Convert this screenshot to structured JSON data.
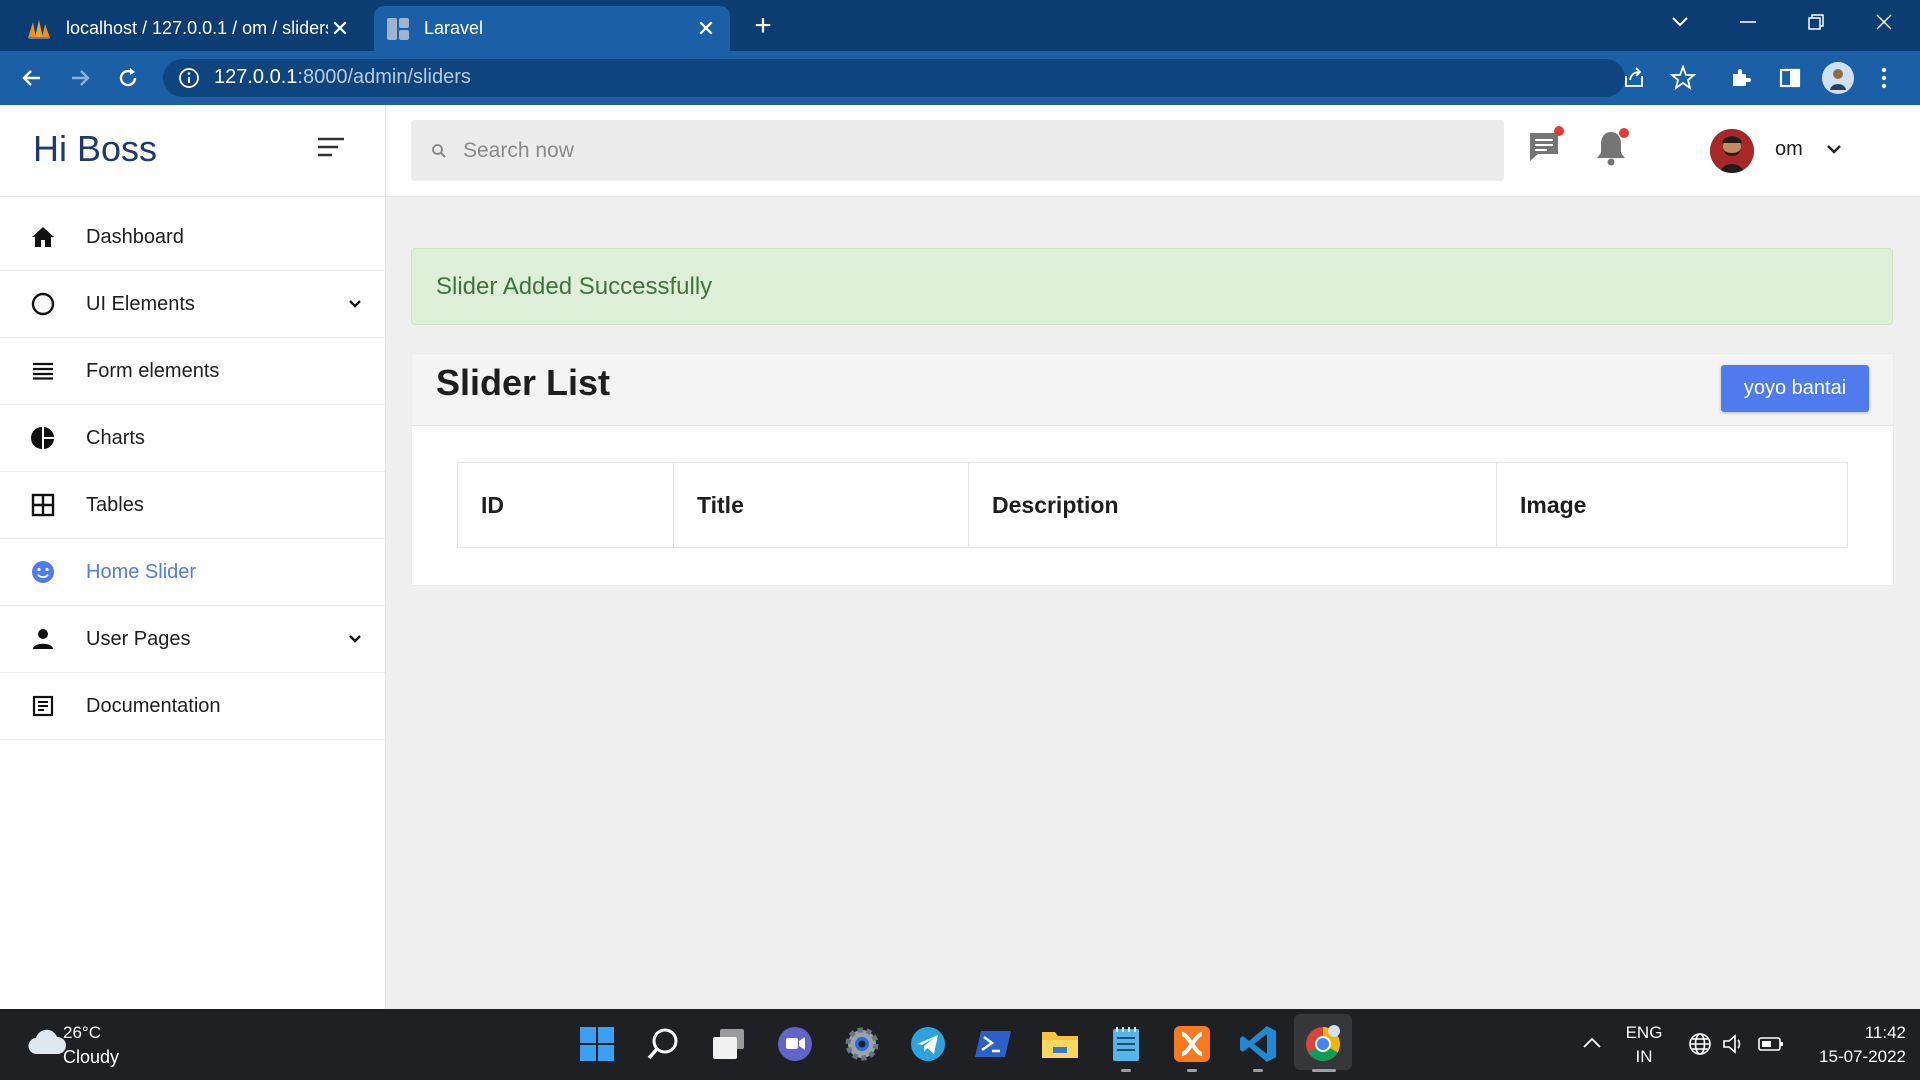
{
  "browser": {
    "tabs": [
      {
        "title": "localhost / 127.0.0.1 / om / sliders",
        "active": false,
        "icon": "phpmyadmin-icon"
      },
      {
        "title": "Laravel",
        "active": true,
        "icon": "laravel-page-icon"
      }
    ],
    "url_host": "127.0.0.1",
    "url_rest": ":8000/admin/sliders"
  },
  "sidebar": {
    "brand": "Hi Boss",
    "items": [
      {
        "label": "Dashboard",
        "icon": "home-icon",
        "active": false,
        "submenu": false
      },
      {
        "label": "UI Elements",
        "icon": "circle-icon",
        "active": false,
        "submenu": true
      },
      {
        "label": "Form elements",
        "icon": "list-icon",
        "active": false,
        "submenu": false
      },
      {
        "label": "Charts",
        "icon": "pie-chart-icon",
        "active": false,
        "submenu": false
      },
      {
        "label": "Tables",
        "icon": "table-icon",
        "active": false,
        "submenu": false
      },
      {
        "label": "Home Slider",
        "icon": "smiley-icon",
        "active": true,
        "submenu": false
      },
      {
        "label": "User Pages",
        "icon": "person-icon",
        "active": false,
        "submenu": true
      },
      {
        "label": "Documentation",
        "icon": "document-icon",
        "active": false,
        "submenu": false
      }
    ]
  },
  "header": {
    "search_placeholder": "Search now",
    "username": "om"
  },
  "main": {
    "alert": "Slider Added Successfully",
    "card_title": "Slider List",
    "add_button": "yoyo bantai",
    "table_headers": [
      "ID",
      "Title",
      "Description",
      "Image"
    ]
  },
  "taskbar": {
    "weather_temp": "26°C",
    "weather_desc": "Cloudy",
    "lang_line1": "ENG",
    "lang_line2": "IN",
    "time": "11:42",
    "date": "15-07-2022"
  },
  "colors": {
    "accent": "#4f7bef",
    "alert_bg": "#dff0d8",
    "alert_text": "#3c763d",
    "tabbar": "#0b3d73",
    "toolbar": "#1b5fa7"
  }
}
